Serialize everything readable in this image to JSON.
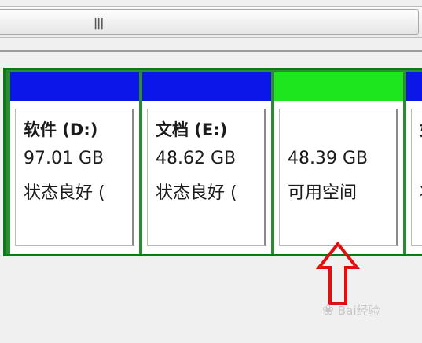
{
  "scrollbar": {
    "grip_icon": "grip-icon"
  },
  "disk": {
    "partitions": [
      {
        "name": "软件  (D:)",
        "size": "97.01 GB",
        "status": "状态良好 (",
        "color": "#0a17e8"
      },
      {
        "name": "文档  (E:)",
        "size": "48.62 GB",
        "status": "状态良好 (",
        "color": "#0a17e8"
      },
      {
        "name": "",
        "size": "48.39 GB",
        "status": "可用空间",
        "color": "#1ee61e"
      },
      {
        "name": "如",
        "size": "",
        "status": "状",
        "color": "#0a17e8"
      }
    ]
  },
  "annotation": {
    "arrow_color": "#e01010",
    "arrow_icon": "up-arrow-icon"
  },
  "watermark": {
    "text": "Bai经验",
    "icon": "paw-icon"
  }
}
